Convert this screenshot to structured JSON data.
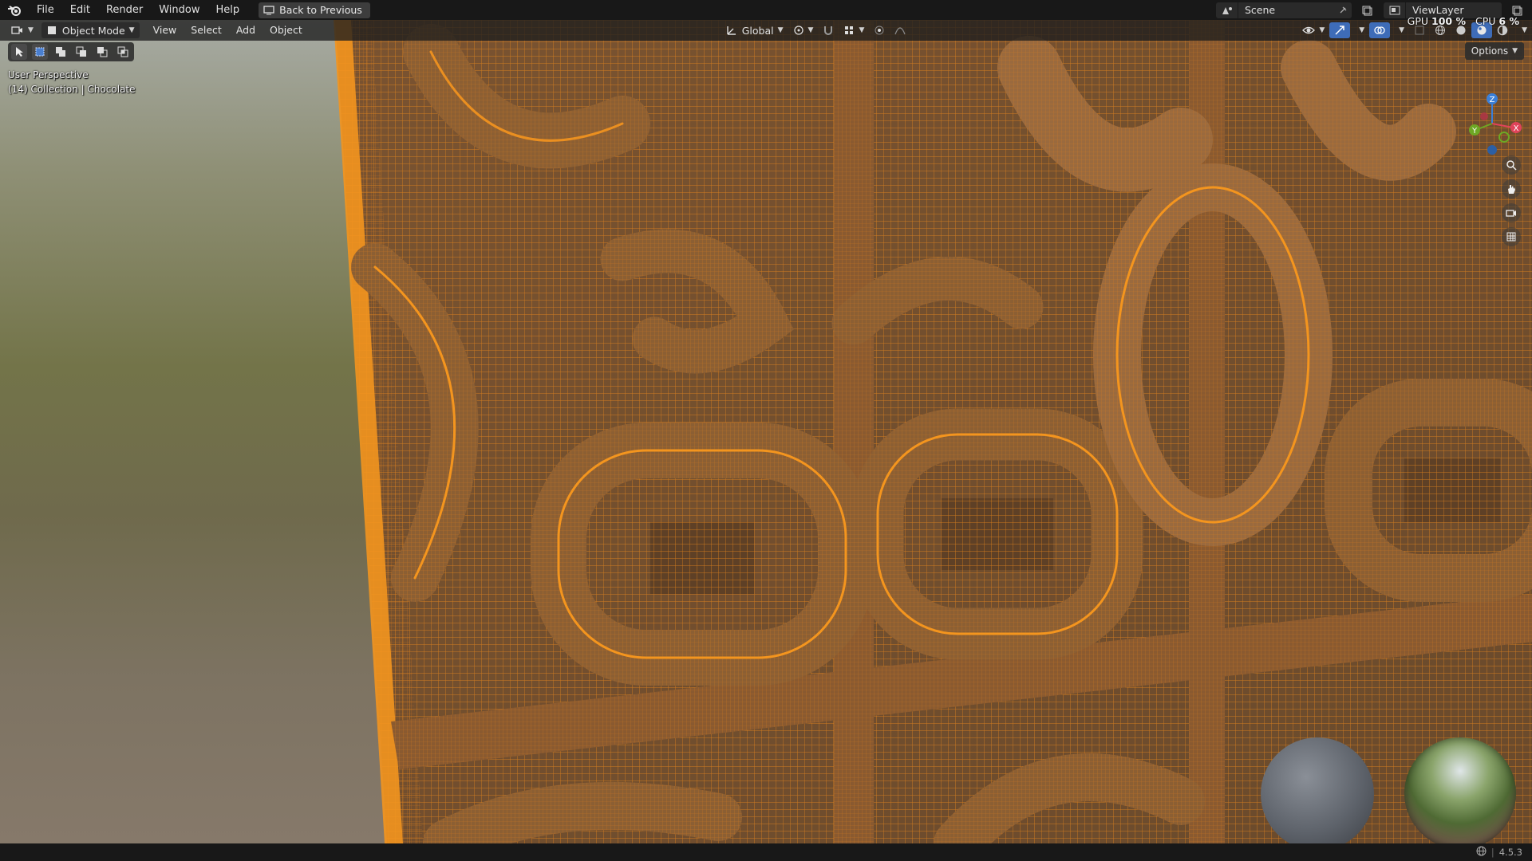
{
  "menu": {
    "items": [
      "File",
      "Edit",
      "Render",
      "Window",
      "Help"
    ],
    "back_button": "Back to Previous"
  },
  "scene": {
    "name": "Scene",
    "view_layer": "ViewLayer"
  },
  "viewport_header": {
    "mode": "Object Mode",
    "menus": [
      "View",
      "Select",
      "Add",
      "Object"
    ],
    "orientation": "Global",
    "options_label": "Options"
  },
  "overlay": {
    "perspective": "User Perspective",
    "collection_info": "(14) Collection | Chocolate"
  },
  "performance": {
    "gpu_label": "GPU",
    "gpu_value": "100 %",
    "cpu_label": "CPU",
    "cpu_value": "6 %"
  },
  "gizmo": {
    "x_label": "X",
    "y_label": "Y",
    "z_label": "Z",
    "x_color": "#e0445a",
    "y_color": "#6ea824",
    "z_color": "#3a7fd8"
  },
  "status": {
    "version": "4.5.3"
  },
  "colors": {
    "wire": "#f08a1c",
    "surface": "#8a5a2e",
    "menubar": "#181818"
  }
}
